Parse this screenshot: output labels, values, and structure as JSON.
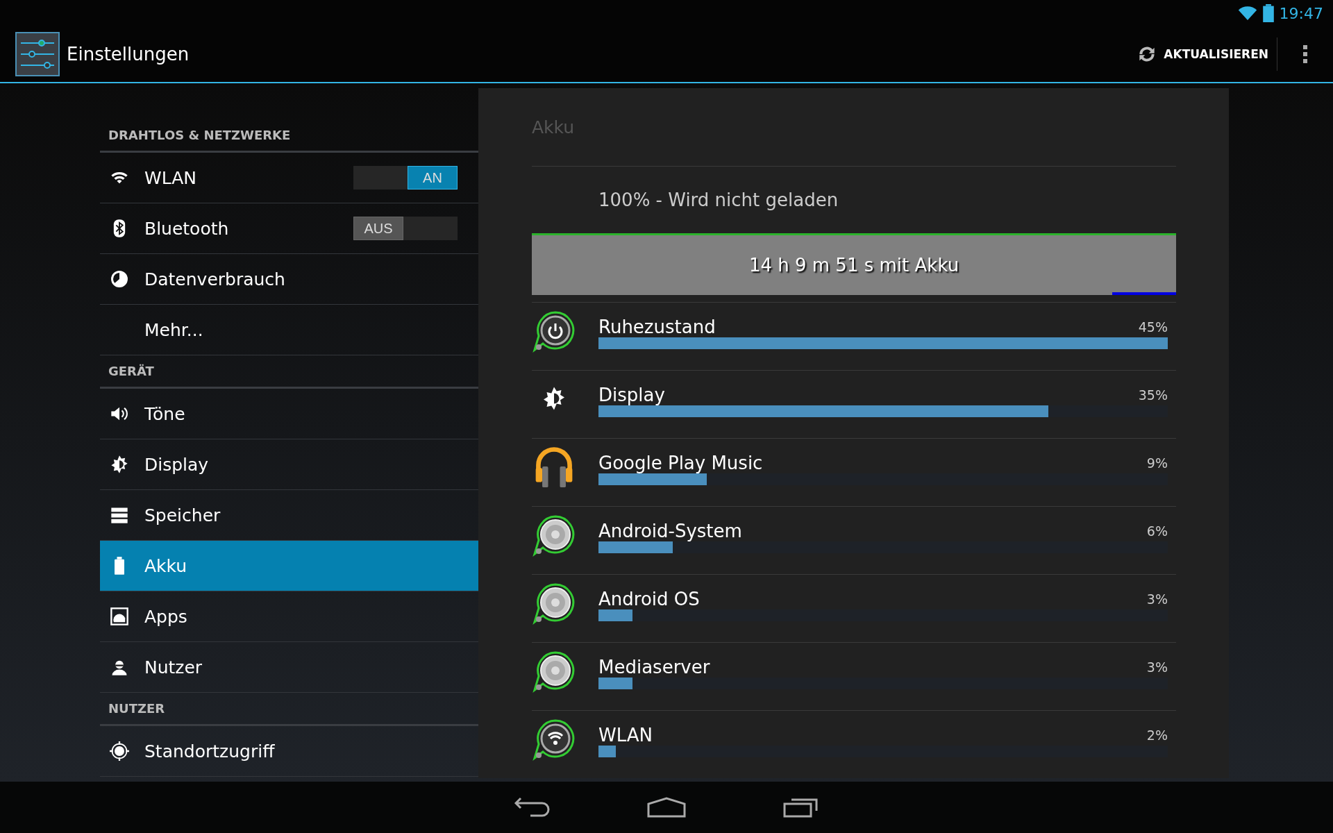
{
  "status_bar": {
    "time": "19:47"
  },
  "action_bar": {
    "title": "Einstellungen",
    "action": "AKTUALISIEREN"
  },
  "sidebar": {
    "sections": [
      {
        "header": "DRAHTLOS & NETZWERKE",
        "items": [
          {
            "label": "WLAN",
            "selected": false,
            "toggle": {
              "label": "AN",
              "on": true
            }
          },
          {
            "label": "Bluetooth",
            "selected": false,
            "toggle": {
              "label": "AUS",
              "on": false
            }
          },
          {
            "label": "Datenverbrauch",
            "selected": false
          },
          {
            "label": "Mehr...",
            "selected": false
          }
        ]
      },
      {
        "header": "GERÄT",
        "items": [
          {
            "label": "Töne",
            "selected": false
          },
          {
            "label": "Display",
            "selected": false
          },
          {
            "label": "Speicher",
            "selected": false
          },
          {
            "label": "Akku",
            "selected": true
          },
          {
            "label": "Apps",
            "selected": false
          },
          {
            "label": "Nutzer",
            "selected": false
          }
        ]
      },
      {
        "header": "NUTZER",
        "items": [
          {
            "label": "Standortzugriff",
            "selected": false
          }
        ]
      }
    ]
  },
  "panel": {
    "title": "Akku",
    "status": "100% - Wird nicht geladen",
    "graph_label": "14 h 9 m 51 s mit Akku",
    "rows": [
      {
        "name": "Ruhezustand",
        "percent": "45%",
        "level": 1.0
      },
      {
        "name": "Display",
        "percent": "35%",
        "level": 0.79
      },
      {
        "name": "Google Play Music",
        "percent": "9%",
        "level": 0.19
      },
      {
        "name": "Android-System",
        "percent": "6%",
        "level": 0.13
      },
      {
        "name": "Android OS",
        "percent": "3%",
        "level": 0.06
      },
      {
        "name": "Mediaserver",
        "percent": "3%",
        "level": 0.06
      },
      {
        "name": "WLAN",
        "percent": "2%",
        "level": 0.03
      }
    ]
  }
}
